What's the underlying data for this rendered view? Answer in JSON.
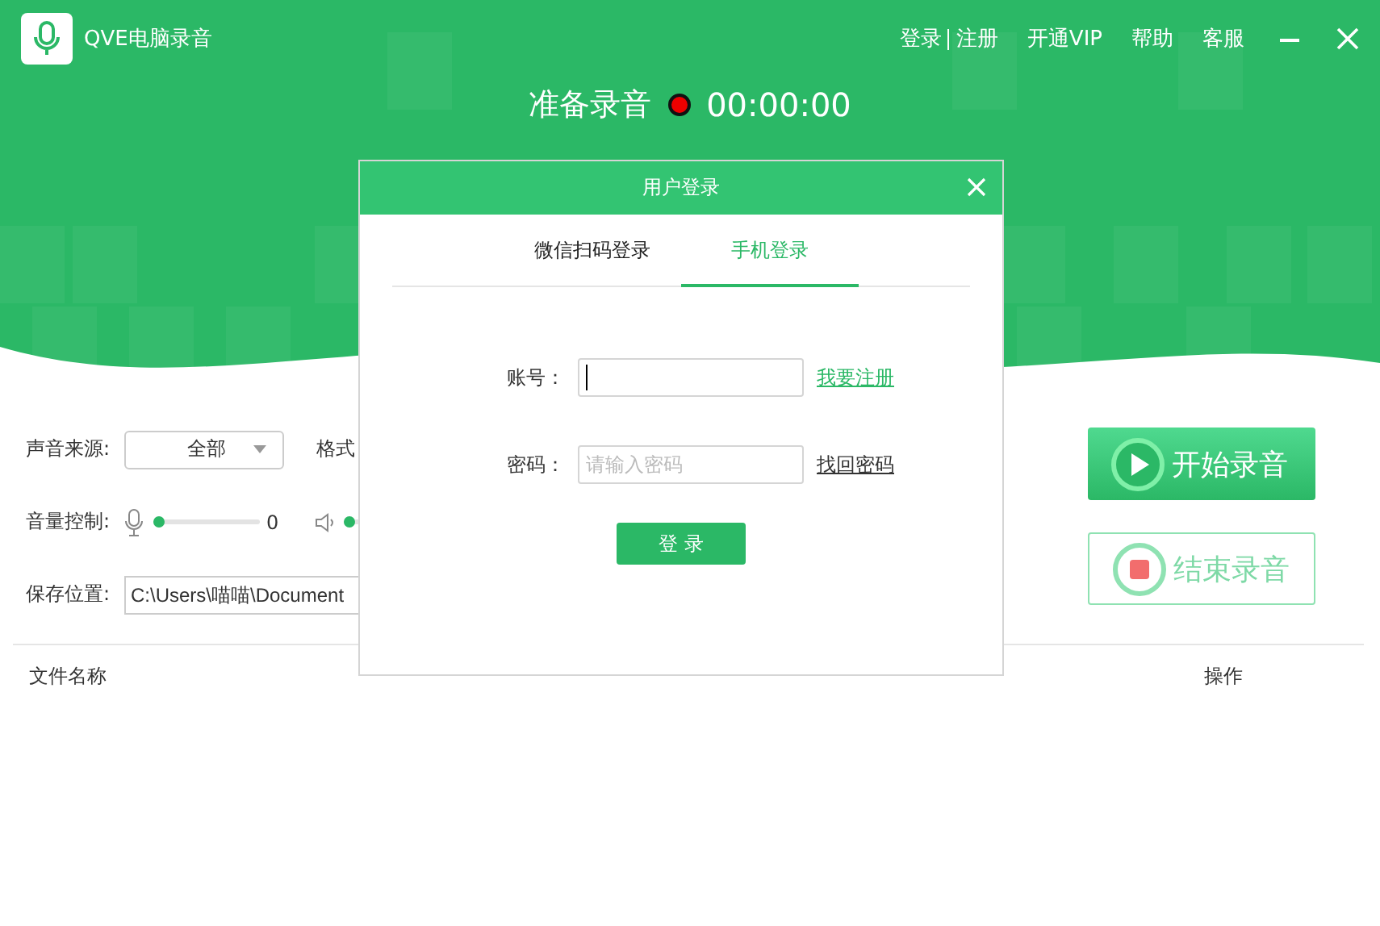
{
  "app": {
    "title": "QVE电脑录音"
  },
  "top_links": [
    {
      "label": "登录"
    },
    {
      "label": "注册"
    },
    {
      "label": "开通VIP"
    },
    {
      "label": "帮助"
    },
    {
      "label": "客服"
    }
  ],
  "status": {
    "label": "准备录音",
    "time": "00:00:00"
  },
  "controls": {
    "source_label": "声音来源:",
    "source_value": "全部",
    "format_label": "格式",
    "volume_label": "音量控制:",
    "mic_slider": {
      "level": 0
    },
    "speaker_slider": {
      "level": 0
    },
    "mic_reading": "0",
    "save_label": "保存位置:",
    "save_path": "C:\\Users\\喵喵\\Document"
  },
  "buttons": [
    {
      "label": "开始录音",
      "kind": "start"
    },
    {
      "label": "结束录音",
      "kind": "stop"
    }
  ],
  "table": {
    "columns": [
      {
        "label": "文件名称"
      },
      {
        "label": "操作"
      }
    ]
  },
  "dialog": {
    "title": "用户登录",
    "tabs": [
      {
        "label": "微信扫码登录",
        "selected": false
      },
      {
        "label": "手机登录",
        "selected": true
      }
    ],
    "account_label": "账号：",
    "register_link": "我要注册",
    "password_label": "密码：",
    "password_placeholder": "请输入密码",
    "recover_link": "找回密码",
    "submit": "登 录"
  }
}
